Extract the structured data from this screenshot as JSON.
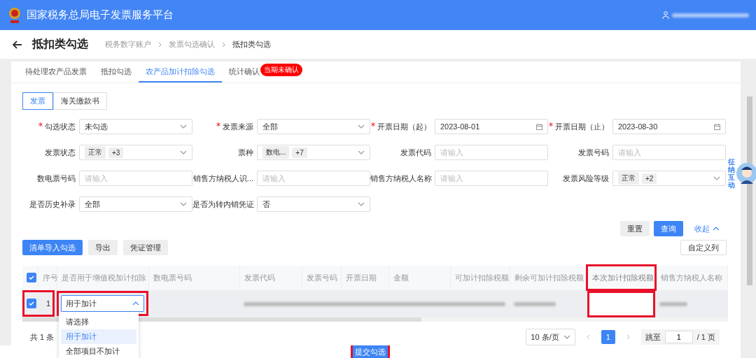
{
  "header": {
    "title": "国家税务总局电子发票服务平台"
  },
  "page": {
    "title": "抵扣类勾选",
    "breadcrumb": [
      {
        "label": "税务数字账户",
        "current": false
      },
      {
        "label": "发票勾选确认",
        "current": false
      },
      {
        "label": "抵扣类勾选",
        "current": true
      }
    ]
  },
  "tabs": [
    {
      "label": "待处理农产品发票",
      "selected": false
    },
    {
      "label": "抵扣勾选",
      "selected": false
    },
    {
      "label": "农产品加计扣除勾选",
      "selected": true
    },
    {
      "label": "统计确认",
      "selected": false,
      "badge": "当期未确认"
    }
  ],
  "doc_types": [
    {
      "label": "发票",
      "selected": true
    },
    {
      "label": "海关缴款书",
      "selected": false
    }
  ],
  "filters": [
    {
      "label": "勾选状态",
      "required": true,
      "kind": "select",
      "value": "未勾选"
    },
    {
      "label": "发票来源",
      "required": true,
      "kind": "select",
      "value": "全部"
    },
    {
      "label": "开票日期（起）",
      "required": true,
      "kind": "date",
      "value": "2023-08-01"
    },
    {
      "label": "开票日期（止）",
      "required": true,
      "kind": "date",
      "value": "2023-08-30"
    },
    {
      "label": "发票状态",
      "required": false,
      "kind": "tags",
      "tags": [
        "正常",
        "+3"
      ]
    },
    {
      "label": "票种",
      "required": false,
      "kind": "tags",
      "tags": [
        "数电...",
        "+7"
      ]
    },
    {
      "label": "发票代码",
      "required": false,
      "kind": "input",
      "placeholder": "请输入"
    },
    {
      "label": "发票号码",
      "required": false,
      "kind": "input",
      "placeholder": "请输入"
    },
    {
      "label": "数电票号码",
      "required": false,
      "kind": "input",
      "placeholder": "请输入"
    },
    {
      "label": "销售方纳税人识...",
      "required": false,
      "kind": "input",
      "placeholder": "请输入"
    },
    {
      "label": "销售方纳税人名称",
      "required": false,
      "kind": "input",
      "placeholder": "请输入"
    },
    {
      "label": "发票风险等级",
      "required": false,
      "kind": "tags",
      "tags": [
        "正常",
        "+2"
      ]
    },
    {
      "label": "是否历史补录",
      "required": false,
      "kind": "select",
      "value": "全部"
    },
    {
      "label": "是否为转内销凭证",
      "required": false,
      "kind": "select",
      "value": "否"
    }
  ],
  "filter_actions": {
    "reset": "重置",
    "query": "查询",
    "collapse": "收起"
  },
  "toolbar": {
    "buttons": [
      {
        "label": "清单导入勾选",
        "kind": "primary"
      },
      {
        "label": "导出",
        "kind": "default"
      },
      {
        "label": "凭证管理",
        "kind": "default"
      }
    ],
    "custom_columns": "自定义列"
  },
  "table": {
    "all_checked": true,
    "columns": [
      {
        "label": "序号",
        "highlighted": false
      },
      {
        "label": "是否用于增值税加计扣除",
        "highlighted": false
      },
      {
        "label": "数电票号码",
        "highlighted": false
      },
      {
        "label": "发票代码",
        "highlighted": false
      },
      {
        "label": "发票号码",
        "highlighted": false
      },
      {
        "label": "开票日期",
        "highlighted": false
      },
      {
        "label": "金额",
        "highlighted": false
      },
      {
        "label": "可加计扣除税额",
        "highlighted": false
      },
      {
        "label": "剩余可加计扣除税额",
        "highlighted": false
      },
      {
        "label": "本次加计扣除税额",
        "highlighted": true
      },
      {
        "label": "销售方纳税人名称",
        "highlighted": false
      }
    ],
    "rows": [
      {
        "checked": true,
        "index": "1",
        "use": "用于加计",
        "dropdown_open": true
      }
    ],
    "dropdown_options": [
      {
        "label": "请选择",
        "selected": false
      },
      {
        "label": "用于加计",
        "selected": true
      },
      {
        "label": "全部项目不加计",
        "selected": false
      }
    ]
  },
  "footer": {
    "total": "共 1 条",
    "page_size": "10 条/页",
    "pages": [
      {
        "label": "1",
        "selected": true
      }
    ],
    "jump_label": "跳至",
    "jump_value": "1",
    "page_total": "/ 1 页"
  },
  "submit": "提交勾选",
  "assistant": {
    "label": "征纳互动"
  }
}
